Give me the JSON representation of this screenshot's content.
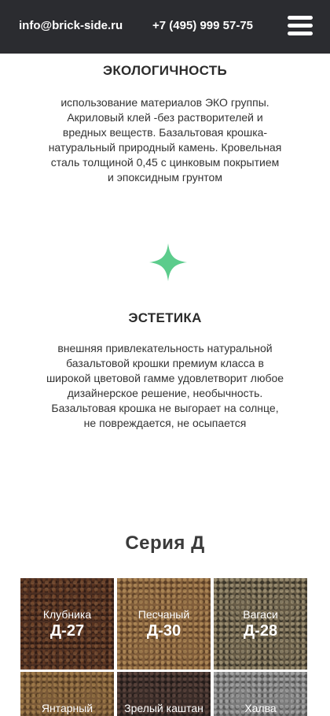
{
  "header": {
    "email": "info@brick-side.ru",
    "phone": "+7 (495) 999 57-75",
    "menu_icon": "hamburger-menu-icon"
  },
  "features": [
    {
      "title": "ЭКОЛОГИЧНОСТЬ",
      "text": "использование материалов ЭКО группы. Акриловый клей -без растворителей и вредных веществ. Базальтовая крошка-натуральный природный камень. Кровельная сталь толщиной 0,45 с цинковым покрытием и эпоксидным грунтом"
    },
    {
      "icon": "sparkle-star-icon",
      "title": "ЭСТЕТИКА",
      "text": "внешняя привлекательность натуральной базальтовой крошки премиум класса в широкой цветовой гамме удовлетворит любое дизайнерское решение, необычность. Базальтовая крошка не выгорает на солнце, не повреждается, не осыпается"
    }
  ],
  "series": {
    "title": "Серия Д",
    "tiles": [
      {
        "name": "Клубника",
        "code": "Д-27"
      },
      {
        "name": "Песчаный",
        "code": "Д-30"
      },
      {
        "name": "Вагаси",
        "code": "Д-28"
      },
      {
        "name": "Янтарный",
        "code": ""
      },
      {
        "name": "Зрелый каштан",
        "code": ""
      },
      {
        "name": "Халва",
        "code": ""
      }
    ]
  },
  "colors": {
    "header_bg": "#2b2c30",
    "accent_star": "#5ccc8c",
    "text": "#2b2b2b"
  }
}
